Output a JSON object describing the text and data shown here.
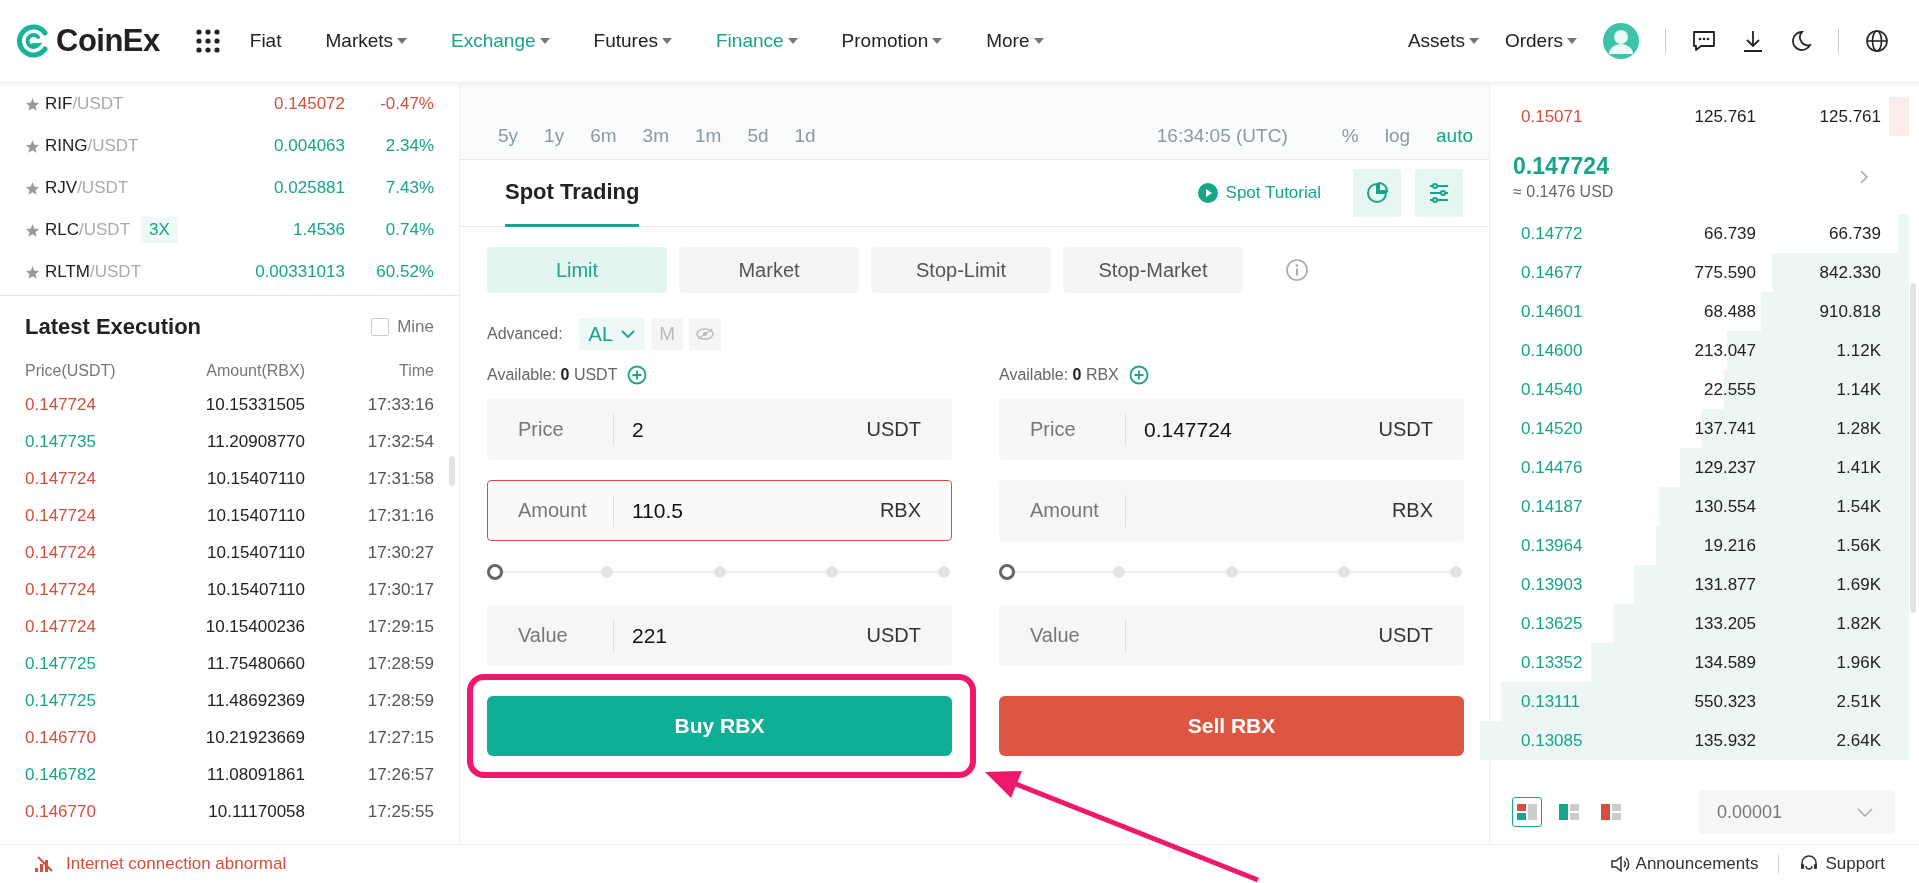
{
  "header": {
    "logo": "CoinEx",
    "nav": [
      {
        "label": "Fiat",
        "dropdown": false,
        "selected": false
      },
      {
        "label": "Markets",
        "dropdown": true,
        "selected": false
      },
      {
        "label": "Exchange",
        "dropdown": true,
        "selected": true
      },
      {
        "label": "Futures",
        "dropdown": true,
        "selected": false
      },
      {
        "label": "Finance",
        "dropdown": true,
        "selected": true
      },
      {
        "label": "Promotion",
        "dropdown": true,
        "selected": false
      },
      {
        "label": "More",
        "dropdown": true,
        "selected": false
      }
    ],
    "account_menu": [
      "Assets",
      "Orders"
    ]
  },
  "markets": [
    {
      "base": "RIF",
      "quote": "/USDT",
      "price": "0.145072",
      "change": "-0.47%",
      "color": "#d64f3d"
    },
    {
      "base": "RING",
      "quote": "/USDT",
      "price": "0.004063",
      "change": "2.34%",
      "color": "#17a58a"
    },
    {
      "base": "RJV",
      "quote": "/USDT",
      "price": "0.025881",
      "change": "7.43%",
      "color": "#17a58a"
    },
    {
      "base": "RLC",
      "quote": "/USDT",
      "badge": "3X",
      "price": "1.4536",
      "change": "0.74%",
      "color": "#17a58a"
    },
    {
      "base": "RLTM",
      "quote": "/USDT",
      "price": "0.00331013",
      "change": "60.52%",
      "color": "#17a58a"
    }
  ],
  "latest_execution": {
    "title": "Latest Execution",
    "mine_label": "Mine",
    "mine_checked": false,
    "columns": [
      "Price(USDT)",
      "Amount(RBX)",
      "Time"
    ],
    "rows": [
      {
        "price": "0.147724",
        "amount": "10.15331505",
        "time": "17:33:16",
        "color": "#d64f3d"
      },
      {
        "price": "0.147735",
        "amount": "11.20908770",
        "time": "17:32:54",
        "color": "#17a58a"
      },
      {
        "price": "0.147724",
        "amount": "10.15407110",
        "time": "17:31:58",
        "color": "#d64f3d"
      },
      {
        "price": "0.147724",
        "amount": "10.15407110",
        "time": "17:31:16",
        "color": "#d64f3d"
      },
      {
        "price": "0.147724",
        "amount": "10.15407110",
        "time": "17:30:27",
        "color": "#d64f3d"
      },
      {
        "price": "0.147724",
        "amount": "10.15407110",
        "time": "17:30:17",
        "color": "#d64f3d"
      },
      {
        "price": "0.147724",
        "amount": "10.15400236",
        "time": "17:29:15",
        "color": "#d64f3d"
      },
      {
        "price": "0.147725",
        "amount": "11.75480660",
        "time": "17:28:59",
        "color": "#17a58a"
      },
      {
        "price": "0.147725",
        "amount": "11.48692369",
        "time": "17:28:59",
        "color": "#17a58a"
      },
      {
        "price": "0.146770",
        "amount": "10.21923669",
        "time": "17:27:15",
        "color": "#d64f3d"
      },
      {
        "price": "0.146782",
        "amount": "11.08091861",
        "time": "17:26:57",
        "color": "#17a58a"
      },
      {
        "price": "0.146770",
        "amount": "10.11170058",
        "time": "17:25:55",
        "color": "#d64f3d"
      }
    ]
  },
  "chart_controls": {
    "ranges": [
      "5y",
      "1y",
      "6m",
      "3m",
      "1m",
      "5d",
      "1d"
    ],
    "time": "16:34:05 (UTC)",
    "scales": [
      {
        "label": "%",
        "selected": false
      },
      {
        "label": "log",
        "selected": false
      },
      {
        "label": "auto",
        "selected": true
      }
    ]
  },
  "spot": {
    "tab": "Spot Trading",
    "tutorial": "Spot Tutorial",
    "order_types": [
      {
        "label": "Limit",
        "selected": true
      },
      {
        "label": "Market",
        "selected": false
      },
      {
        "label": "Stop-Limit",
        "selected": false
      },
      {
        "label": "Stop-Market",
        "selected": false
      }
    ],
    "advanced": {
      "label": "Advanced:",
      "mode": "AL",
      "option": "M"
    },
    "forms": [
      {
        "kind": "buy",
        "available_label": "Available:",
        "available_amount": "0",
        "available_unit": "USDT",
        "fields": [
          {
            "label": "Price",
            "value": "2",
            "unit": "USDT",
            "error": false
          },
          {
            "label": "Amount",
            "value": "110.5",
            "unit": "RBX",
            "error": true
          },
          {
            "label": "Value",
            "value": "221",
            "unit": "USDT",
            "error": false
          }
        ],
        "slider": {
          "level": 0
        },
        "button": "Buy RBX"
      },
      {
        "kind": "sell",
        "available_label": "Available:",
        "available_amount": "0",
        "available_unit": "RBX",
        "fields": [
          {
            "label": "Price",
            "value": "0.147724",
            "unit": "USDT",
            "error": false
          },
          {
            "label": "Amount",
            "unit": "RBX",
            "error": false
          },
          {
            "label": "Value",
            "unit": "USDT",
            "error": false
          }
        ],
        "slider": {
          "level": 0
        },
        "button": "Sell RBX"
      }
    ]
  },
  "order_book": {
    "asks": [
      {
        "price": "0.15071",
        "amount": "125.761",
        "total": "125.761"
      }
    ],
    "last_price": "0.147724",
    "last_price_usd": "≈ 0.1476 USD",
    "bids": [
      {
        "price": "0.14772",
        "amount": "66.739",
        "total": "66.739"
      },
      {
        "price": "0.14677",
        "amount": "775.590",
        "total": "842.330"
      },
      {
        "price": "0.14601",
        "amount": "68.488",
        "total": "910.818"
      },
      {
        "price": "0.14600",
        "amount": "213.047",
        "total": "1.12K"
      },
      {
        "price": "0.14540",
        "amount": "22.555",
        "total": "1.14K"
      },
      {
        "price": "0.14520",
        "amount": "137.741",
        "total": "1.28K"
      },
      {
        "price": "0.14476",
        "amount": "129.237",
        "total": "1.41K"
      },
      {
        "price": "0.14187",
        "amount": "130.554",
        "total": "1.54K"
      },
      {
        "price": "0.13964",
        "amount": "19.216",
        "total": "1.56K"
      },
      {
        "price": "0.13903",
        "amount": "131.877",
        "total": "1.69K"
      },
      {
        "price": "0.13625",
        "amount": "133.205",
        "total": "1.82K"
      },
      {
        "price": "0.13352",
        "amount": "134.589",
        "total": "1.96K"
      },
      {
        "price": "0.13111",
        "amount": "550.323",
        "total": "2.51K"
      },
      {
        "price": "0.13085",
        "amount": "135.932",
        "total": "2.64K"
      }
    ],
    "views": [
      {
        "kind": "both",
        "selected": true
      },
      {
        "kind": "bids",
        "selected": false
      },
      {
        "kind": "asks",
        "selected": false
      }
    ],
    "precision": "0.00001"
  },
  "status_bar": {
    "connection": "Internet connection abnormal",
    "announcements": "Announcements",
    "support": "Support"
  },
  "annotation": {
    "frame": true,
    "arrow": true
  }
}
